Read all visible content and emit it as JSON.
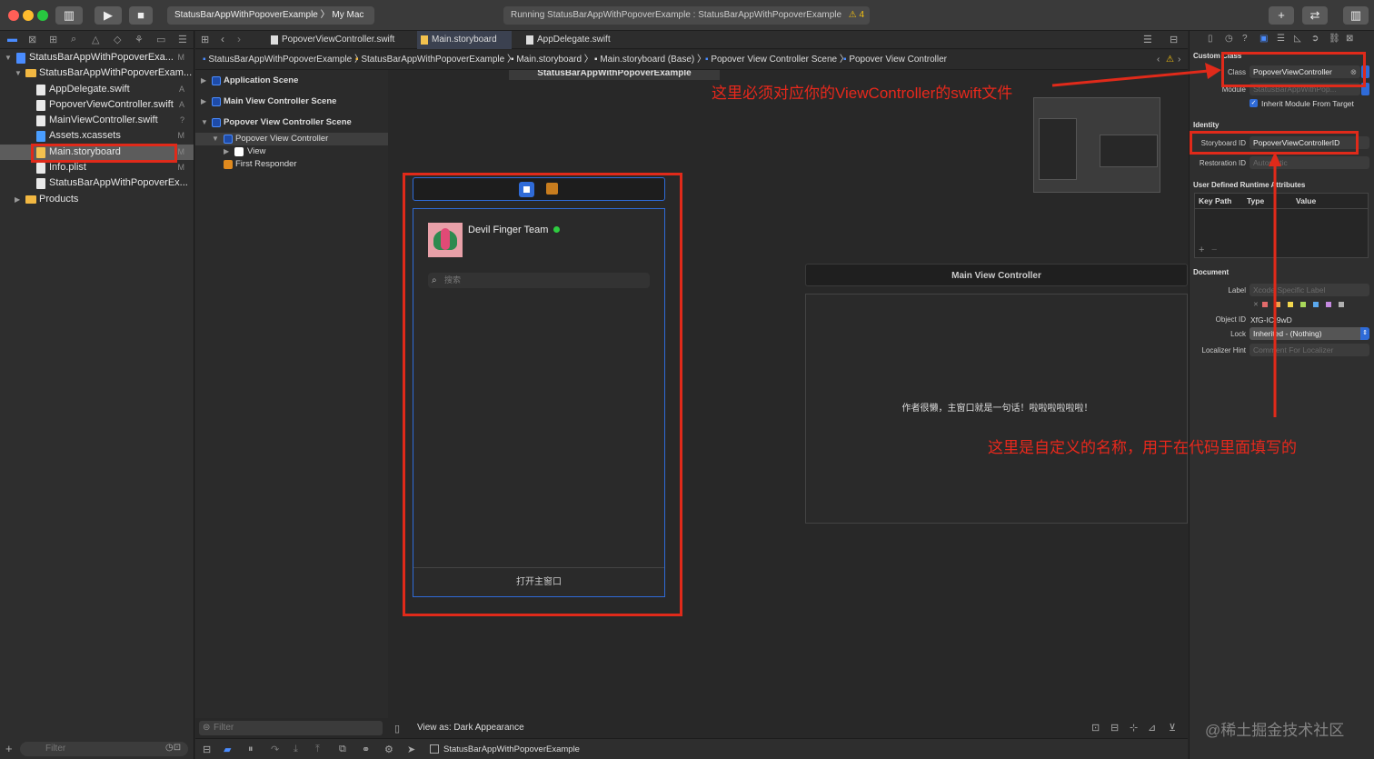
{
  "toolbar": {
    "scheme": "StatusBarAppWithPopoverExample 〉 My Mac",
    "activity": "Running StatusBarAppWithPopoverExample : StatusBarAppWithPopoverExample",
    "warnings": "4"
  },
  "navigator": {
    "items": [
      {
        "label": "StatusBarAppWithPopoverExa...",
        "status": "M"
      },
      {
        "label": "StatusBarAppWithPopoverExam...",
        "status": ""
      },
      {
        "label": "AppDelegate.swift",
        "status": "A"
      },
      {
        "label": "PopoverViewController.swift",
        "status": "A"
      },
      {
        "label": "MainViewController.swift",
        "status": "?"
      },
      {
        "label": "Assets.xcassets",
        "status": "M"
      },
      {
        "label": "Main.storyboard",
        "status": "M"
      },
      {
        "label": "Info.plist",
        "status": "M"
      },
      {
        "label": "StatusBarAppWithPopoverEx...",
        "status": ""
      },
      {
        "label": "Products",
        "status": ""
      }
    ],
    "filter_placeholder": "Filter"
  },
  "tabs": [
    "PopoverViewController.swift",
    "Main.storyboard",
    "AppDelegate.swift"
  ],
  "jumpbar": [
    "StatusBarAppWithPopoverExample",
    "StatusBarAppWithPopoverExample",
    "Main.storyboard",
    "Main.storyboard (Base)",
    "Popover View Controller Scene",
    "Popover View Controller"
  ],
  "outline": {
    "items": [
      "Application Scene",
      "Main View Controller Scene",
      "Popover View Controller Scene",
      "Popover View Controller",
      "View",
      "First Responder"
    ]
  },
  "canvas": {
    "top_title": "StatusBarAppWithPopoverExample",
    "popover": {
      "team": "Devil Finger Team",
      "search_placeholder": "搜索",
      "open_button": "打开主窗口"
    },
    "main_vc": {
      "title": "Main View Controller",
      "text": "作者很懒，主窗口就是一句话！啦啦啦啦啦啦！"
    },
    "filter_placeholder": "Filter",
    "view_as": "View as: Dark Appearance",
    "status_target": "StatusBarAppWithPopoverExample"
  },
  "inspector": {
    "custom_class_header": "Custom Class",
    "class_label": "Class",
    "class_value": "PopoverViewController",
    "module_label": "Module",
    "module_value": "StatusBarAppWithPop...",
    "inherit_label": "Inherit Module From Target",
    "identity_header": "Identity",
    "storyboard_id_label": "Storyboard ID",
    "storyboard_id_value": "PopoverViewControllerID",
    "restoration_label": "Restoration ID",
    "restoration_placeholder": "Automatic",
    "udra_header": "User Defined Runtime Attributes",
    "udra_cols": [
      "Key Path",
      "Type",
      "Value"
    ],
    "document_header": "Document",
    "doc_label_label": "Label",
    "doc_label_placeholder": "Xcode Specific Label",
    "object_id_label": "Object ID",
    "object_id_value": "XfG-IC-9wD",
    "lock_label": "Lock",
    "lock_value": "Inherited - (Nothing)",
    "localizer_label": "Localizer Hint",
    "localizer_placeholder": "Comment For Localizer",
    "label_colors": [
      "#e26a6a",
      "#f0a04b",
      "#f2d74e",
      "#a8d85a",
      "#5aa8ee",
      "#c58ae0",
      "#b0b0b0"
    ]
  },
  "annotations": {
    "top": "这里必须对应你的ViewController的swift文件",
    "bottom": "这里是自定义的名称，用于在代码里面填写的",
    "watermark": "@稀土掘金技术社区"
  }
}
